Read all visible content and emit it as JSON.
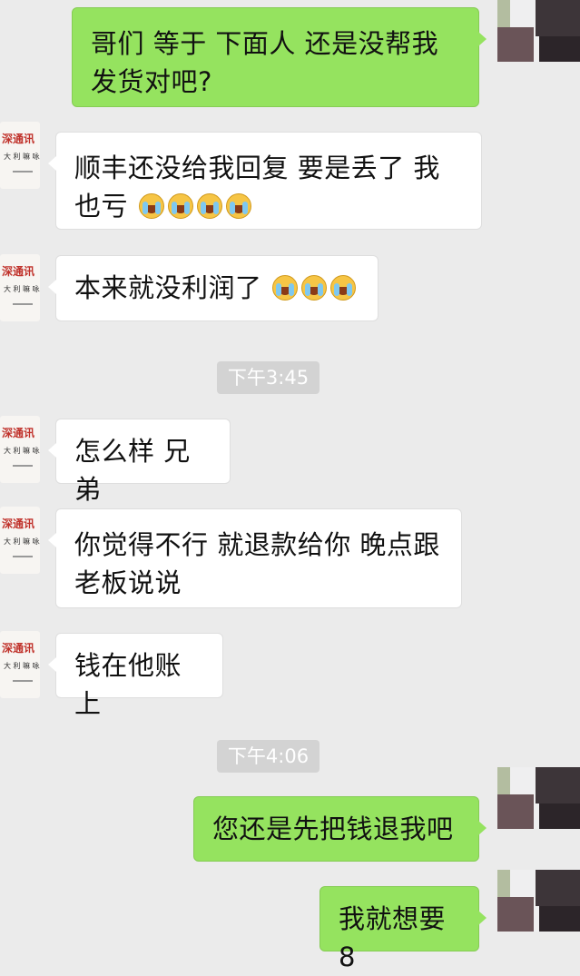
{
  "messages": [
    {
      "side": "out",
      "text": "哥们 等于 下面人 还是没帮我发货对吧?"
    },
    {
      "side": "in",
      "text": "顺丰还没给我回复 要是丢了 我也亏",
      "emoji": "cry-emoji",
      "emoji_count": 4
    },
    {
      "side": "in",
      "text": "本来就没利润了",
      "emoji": "cry-emoji",
      "emoji_count": 3
    },
    {
      "side": "time",
      "text": "下午3:45"
    },
    {
      "side": "in",
      "text": "怎么样 兄弟"
    },
    {
      "side": "in",
      "text": "你觉得不行 就退款给你  晚点跟老板说说"
    },
    {
      "side": "in",
      "text": "钱在他账上"
    },
    {
      "side": "time",
      "text": "下午4:06"
    },
    {
      "side": "out",
      "text": "您还是先把钱退我吧"
    },
    {
      "side": "out",
      "text": "我就想要8"
    }
  ],
  "avatar_in_text": "深通讯",
  "colors": {
    "out_bubble": "#95e35f",
    "in_bubble": "#ffffff",
    "background": "#ebebeb"
  }
}
